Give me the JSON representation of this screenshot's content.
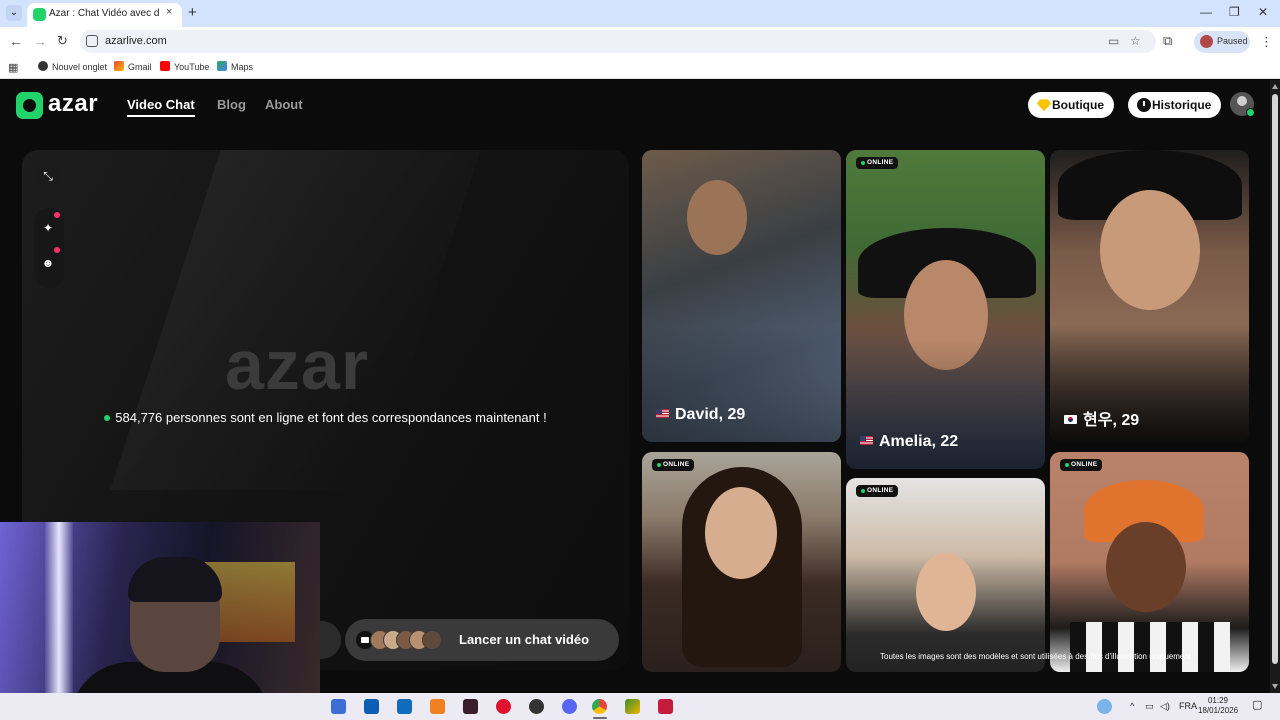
{
  "browser": {
    "tab_title": "Azar : Chat Vidéo avec de nouv",
    "url": "azarlive.com",
    "profile_label": "Paused",
    "bookmarks": [
      "Nouvel onglet",
      "Gmail",
      "YouTube",
      "Maps"
    ]
  },
  "site": {
    "logo_text": "azar",
    "nav": [
      "Video Chat",
      "Blog",
      "About"
    ],
    "shop_label": "Boutique",
    "history_label": "Historique",
    "hero_logo": "azar",
    "online_text": "584,776 personnes sont en ligne et font des correspondances maintenant !",
    "launch_label": "Lancer un chat vidéo",
    "disclaimer": "Toutes les images sont des modèles et sont utilisées à des fins d'illustration uniquement."
  },
  "profiles": [
    {
      "name": "David, 29",
      "flag": "us-flag"
    },
    {
      "name": "Amelia, 22",
      "flag": "us-flag",
      "badge": "ONLINE"
    },
    {
      "name": "현우, 29",
      "flag": "kr-flag"
    },
    {
      "badge": "ONLINE"
    },
    {
      "badge": "ONLINE"
    },
    {
      "badge": "ONLINE"
    }
  ],
  "taskbar": {
    "lang": "FRA",
    "time": "01:29",
    "date": "18/01/2026"
  },
  "colors": {
    "brand_green": "#22d36b",
    "notification_red": "#ff2f6b",
    "page_bg": "#0b0b0b"
  }
}
